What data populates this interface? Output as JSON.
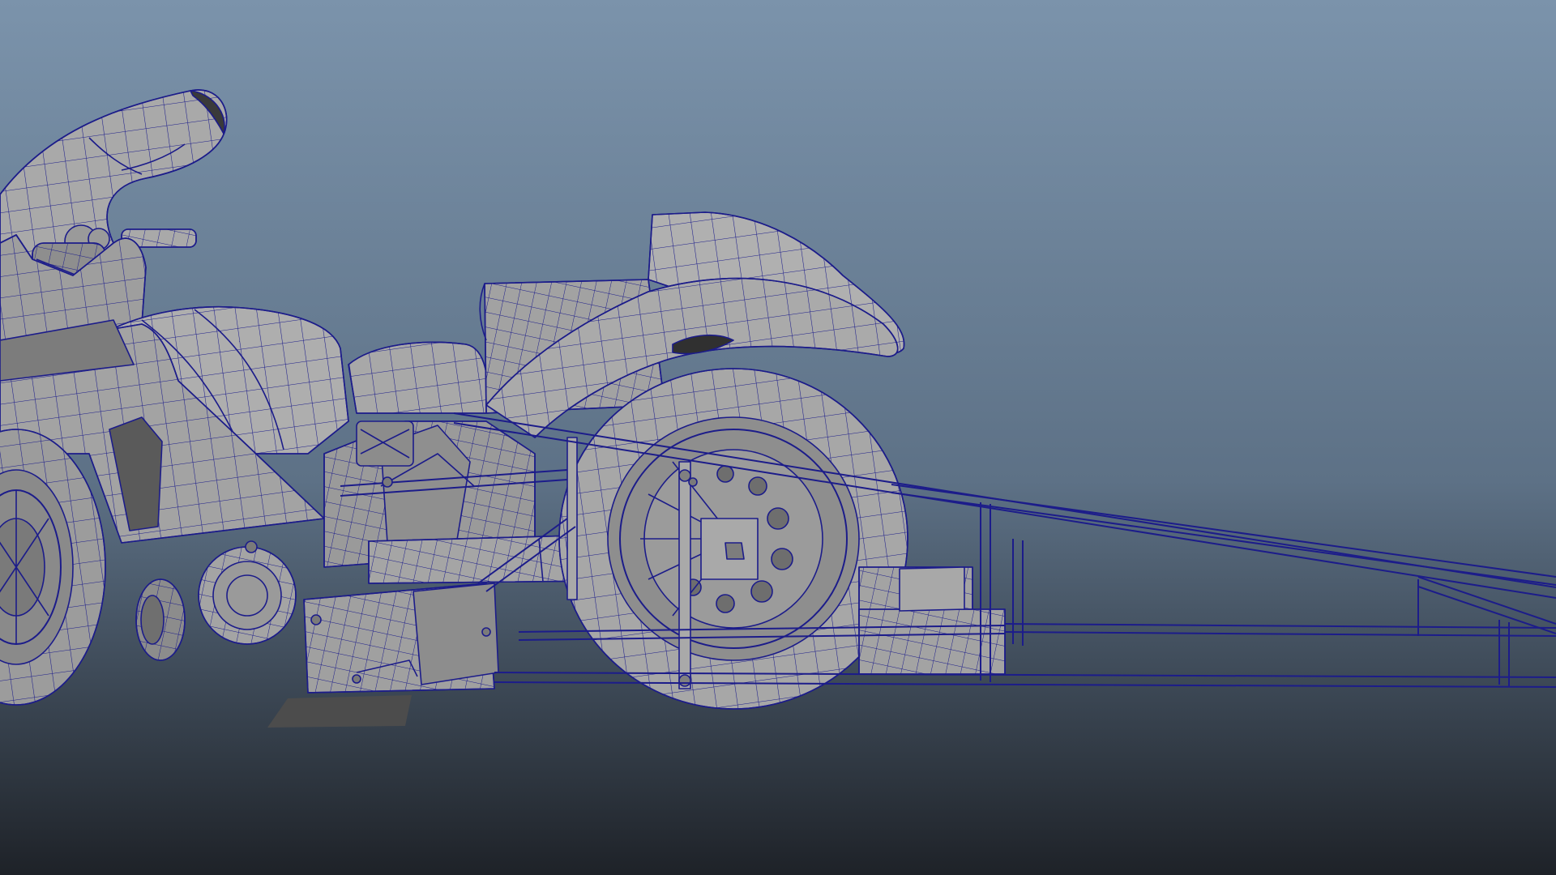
{
  "viewport": {
    "background_top": "#7b93ab",
    "background_mid": "#5d7186",
    "background_bottom": "#1e2228"
  },
  "model": {
    "surface_color": "#9b9b9b",
    "surface_light": "#b4b4b4",
    "surface_dark": "#6e6e6e",
    "wire_color": "#1c1c8a",
    "shadow_color": "#4a4a4a"
  }
}
